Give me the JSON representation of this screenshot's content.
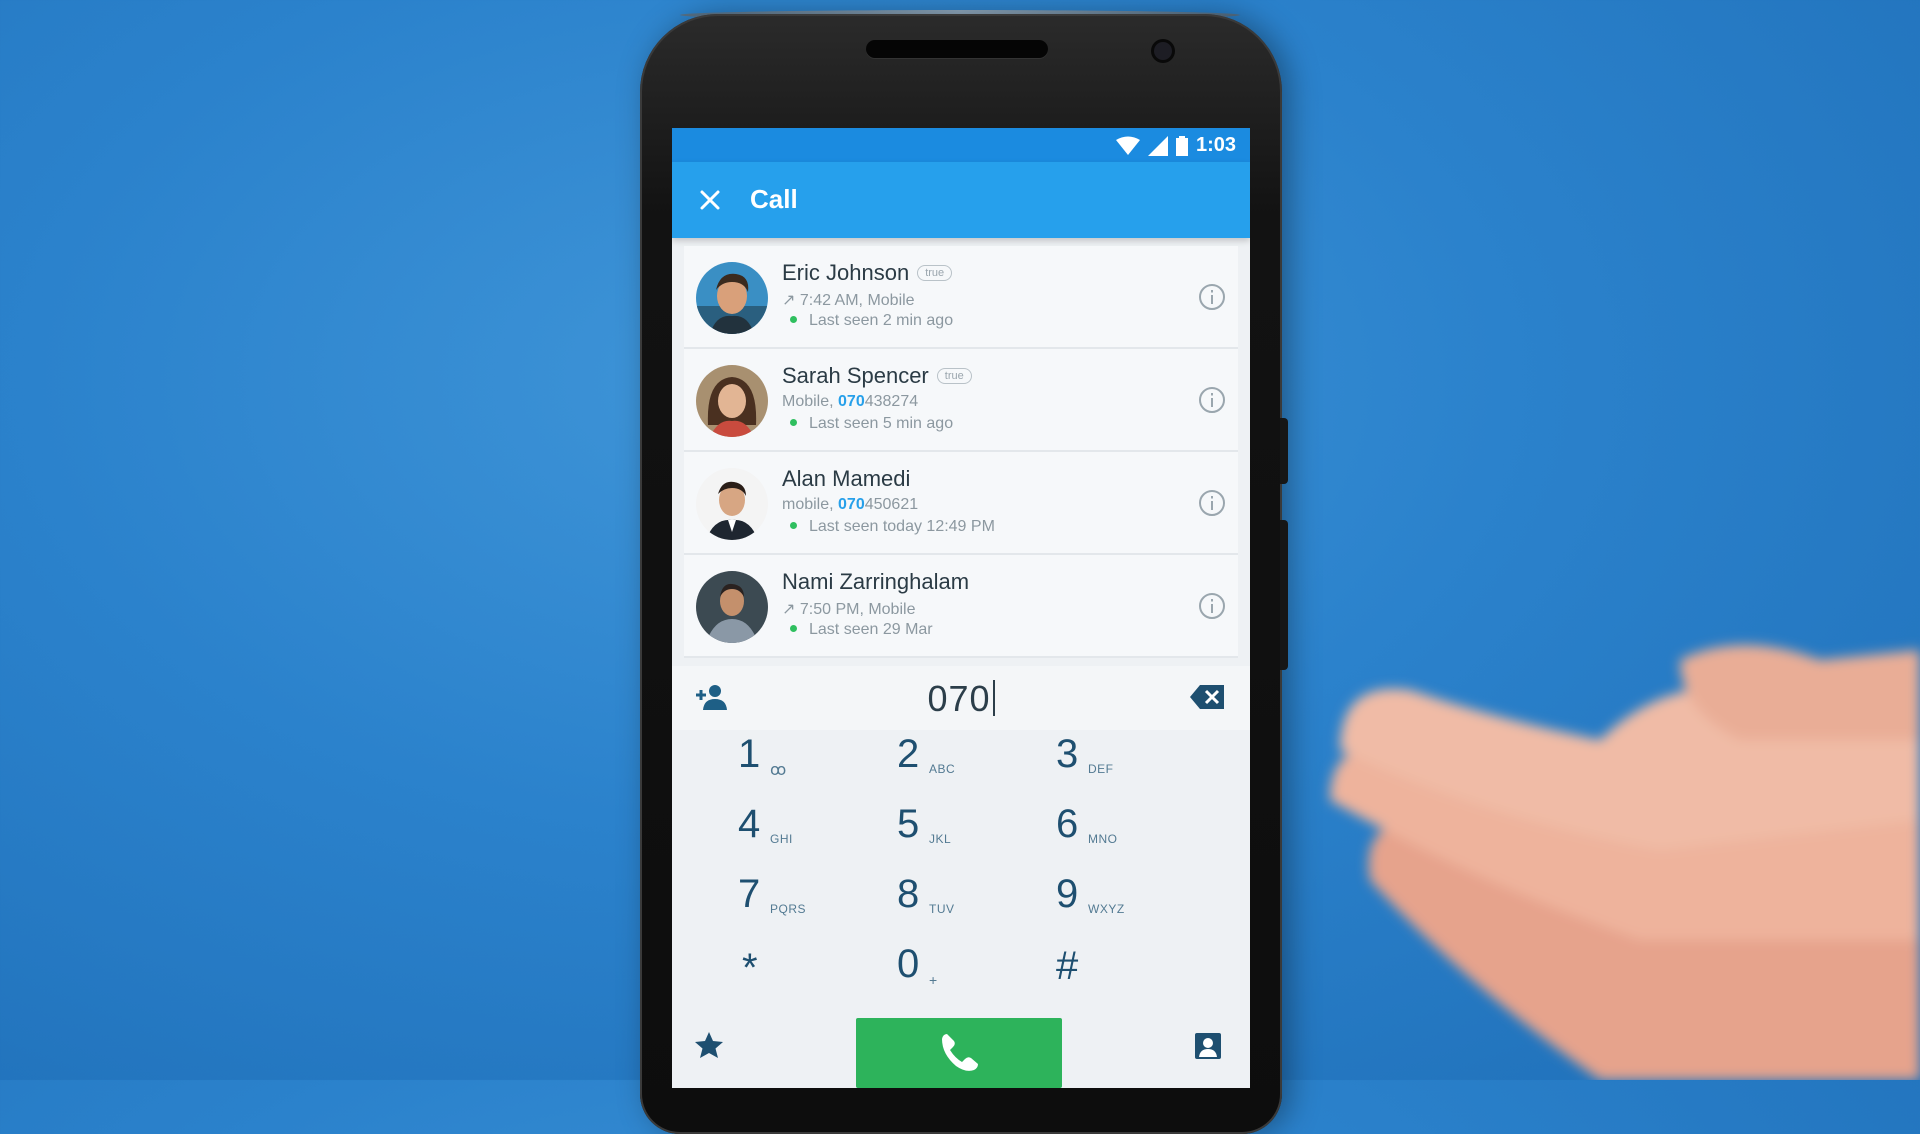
{
  "status_bar": {
    "time": "1:03"
  },
  "app_bar": {
    "title": "Call"
  },
  "contacts": [
    {
      "name": "Eric Johnson",
      "badge": "true",
      "detail_pre": "↗ 7:42 AM, Mobile",
      "detail_hl": "",
      "detail_post": "",
      "last_seen": "Last seen 2 min ago"
    },
    {
      "name": "Sarah Spencer",
      "badge": "true",
      "detail_pre": "Mobile, ",
      "detail_hl": "070",
      "detail_post": "438274",
      "last_seen": "Last seen 5 min ago"
    },
    {
      "name": "Alan Mamedi",
      "badge": "",
      "detail_pre": "mobile, ",
      "detail_hl": "070",
      "detail_post": "450621",
      "last_seen": "Last seen today 12:49 PM"
    },
    {
      "name": "Nami Zarringhalam",
      "badge": "",
      "detail_pre": "↗ 7:50 PM, Mobile",
      "detail_hl": "",
      "detail_post": "",
      "last_seen": "Last seen 29 Mar"
    }
  ],
  "dialer": {
    "input_value": "070",
    "keys": [
      {
        "digit": "1",
        "letters": "ꝏ"
      },
      {
        "digit": "2",
        "letters": "ABC"
      },
      {
        "digit": "3",
        "letters": "DEF"
      },
      {
        "digit": "4",
        "letters": "GHI"
      },
      {
        "digit": "5",
        "letters": "JKL"
      },
      {
        "digit": "6",
        "letters": "MNO"
      },
      {
        "digit": "7",
        "letters": "PQRS"
      },
      {
        "digit": "8",
        "letters": "TUV"
      },
      {
        "digit": "9",
        "letters": "WXYZ"
      },
      {
        "digit": "*",
        "letters": ""
      },
      {
        "digit": "0",
        "letters": "+"
      },
      {
        "digit": "#",
        "letters": ""
      }
    ]
  },
  "icons": {
    "close": "close-icon",
    "wifi": "wifi-icon",
    "signal": "signal-icon",
    "battery": "battery-icon",
    "info": "info-icon",
    "add_contact": "add-contact-icon",
    "backspace": "backspace-icon",
    "star": "star-icon",
    "phone": "phone-icon",
    "contacts": "contacts-icon"
  },
  "colors": {
    "status_bar": "#1b8be0",
    "app_bar": "#26a0ec",
    "call_button": "#2db35b",
    "highlight": "#27a0ea",
    "online_dot": "#2fbf5f",
    "background": "#2b82cc"
  }
}
